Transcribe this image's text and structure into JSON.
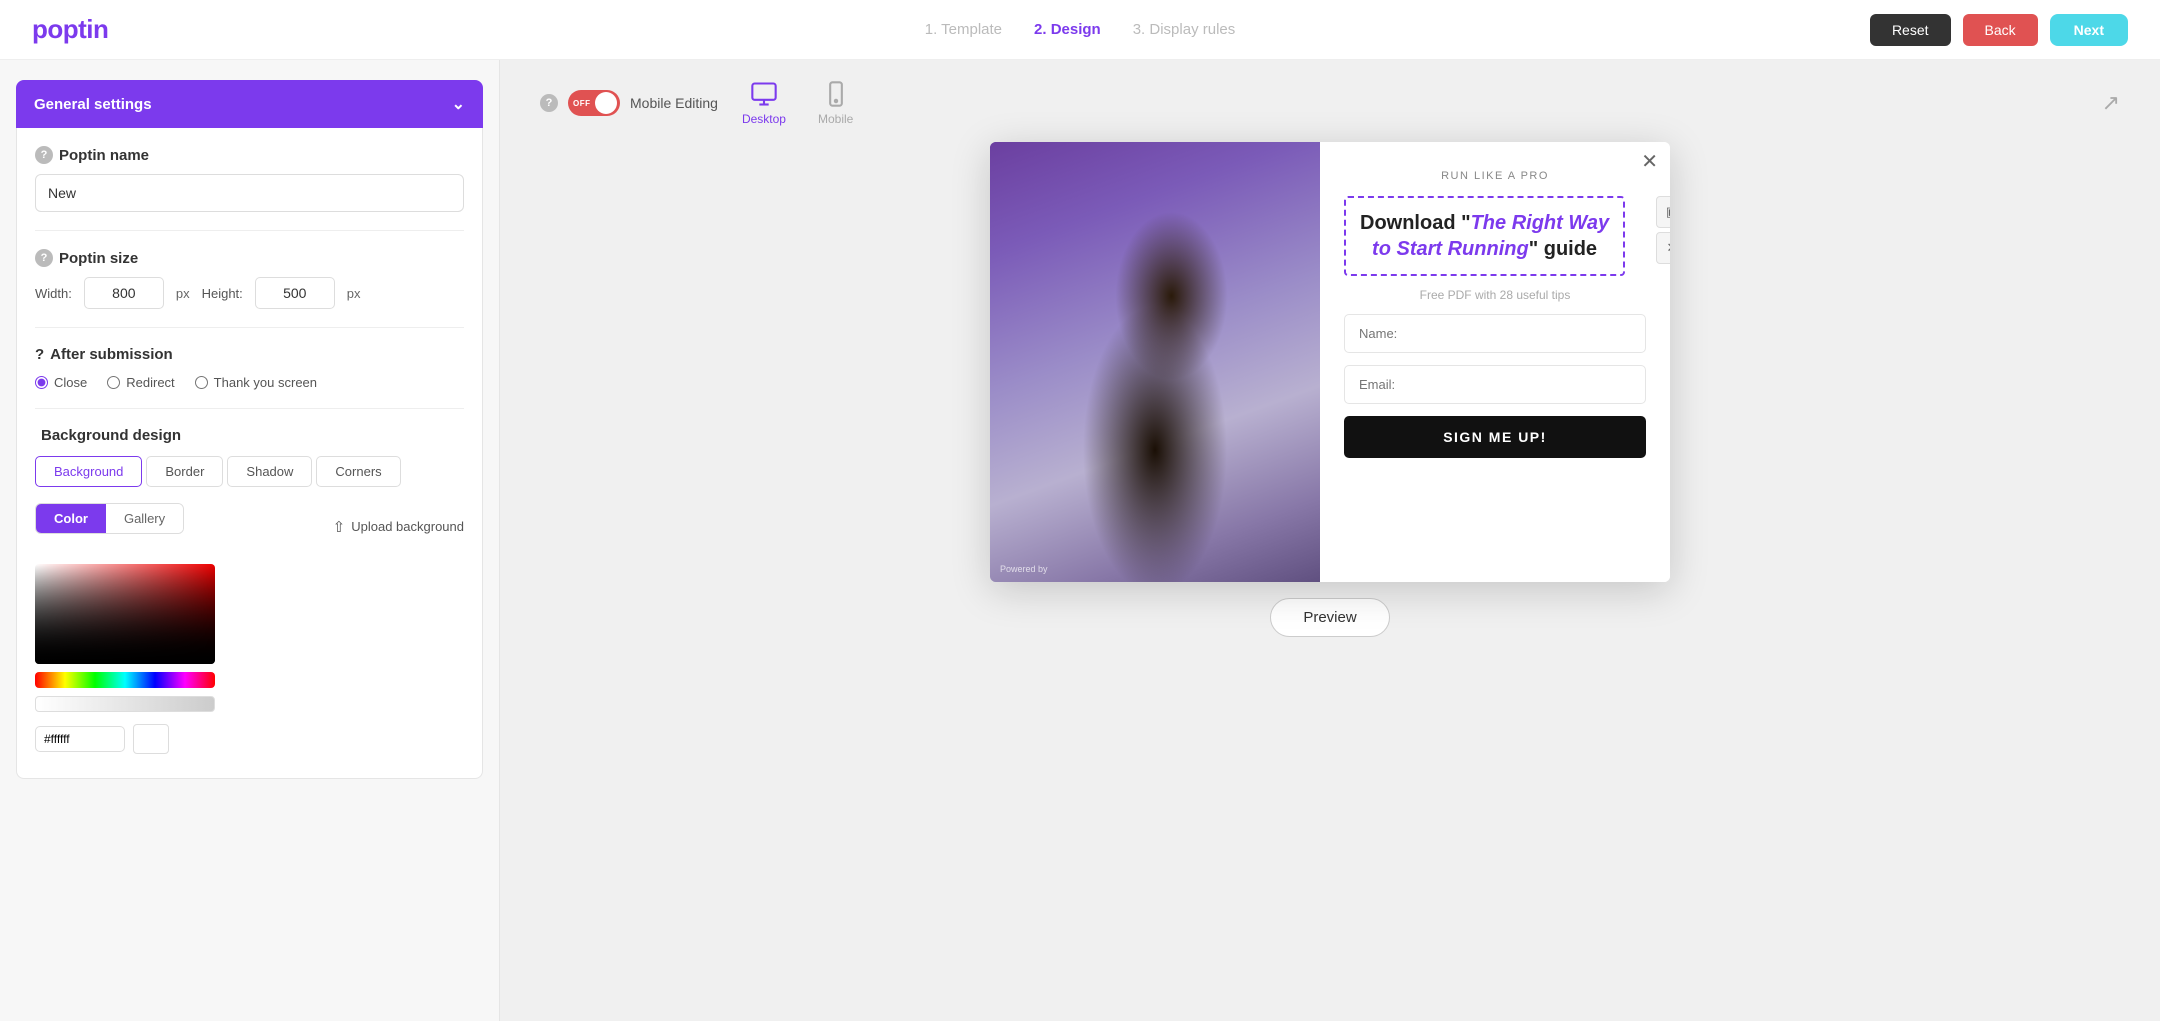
{
  "brand": {
    "logo": "poptin"
  },
  "nav": {
    "steps": [
      {
        "id": "template",
        "label": "1. Template",
        "state": "inactive"
      },
      {
        "id": "design",
        "label": "2. Design",
        "state": "active"
      },
      {
        "id": "display_rules",
        "label": "3. Display rules",
        "state": "inactive"
      }
    ],
    "reset_label": "Reset",
    "back_label": "Back",
    "next_label": "Next"
  },
  "left_panel": {
    "general_settings": {
      "title": "General settings",
      "poptin_name": {
        "label": "Poptin name",
        "value": "New",
        "placeholder": "New"
      },
      "poptin_size": {
        "label": "Poptin size",
        "width_label": "Width:",
        "width_value": "800",
        "width_unit": "px",
        "height_label": "Height:",
        "height_value": "500",
        "height_unit": "px"
      },
      "after_submission": {
        "label": "After submission",
        "options": [
          {
            "id": "close",
            "label": "Close",
            "selected": true
          },
          {
            "id": "redirect",
            "label": "Redirect",
            "selected": false
          },
          {
            "id": "thank_you",
            "label": "Thank you screen",
            "selected": false
          }
        ]
      },
      "background_design": {
        "label": "Background design",
        "tabs": [
          {
            "id": "background",
            "label": "Background",
            "active": true
          },
          {
            "id": "border",
            "label": "Border",
            "active": false
          },
          {
            "id": "shadow",
            "label": "Shadow",
            "active": false
          },
          {
            "id": "corners",
            "label": "Corners",
            "active": false
          }
        ],
        "color_gallery_tabs": [
          {
            "id": "color",
            "label": "Color",
            "active": true
          },
          {
            "id": "gallery",
            "label": "Gallery",
            "active": false
          }
        ],
        "upload_label": "Upload background",
        "hex_value": "#ffffff"
      }
    }
  },
  "right_panel": {
    "mobile_editing": {
      "toggle_state": "OFF",
      "label": "Mobile Editing"
    },
    "device_tabs": [
      {
        "id": "desktop",
        "label": "Desktop",
        "active": true,
        "icon": "desktop-icon"
      },
      {
        "id": "mobile",
        "label": "Mobile",
        "active": false,
        "icon": "mobile-icon"
      }
    ],
    "popup": {
      "subtitle": "RUN LIKE A PRO",
      "title_part1": "Download \"",
      "title_italic": "The Right Way to Start Running",
      "title_part2": "\" guide",
      "description": "Free PDF with 28 useful tips",
      "name_placeholder": "Name:",
      "email_placeholder": "Email:",
      "submit_label": "SIGN ME UP!",
      "powered_by": "Powered by"
    },
    "preview_label": "Preview"
  }
}
